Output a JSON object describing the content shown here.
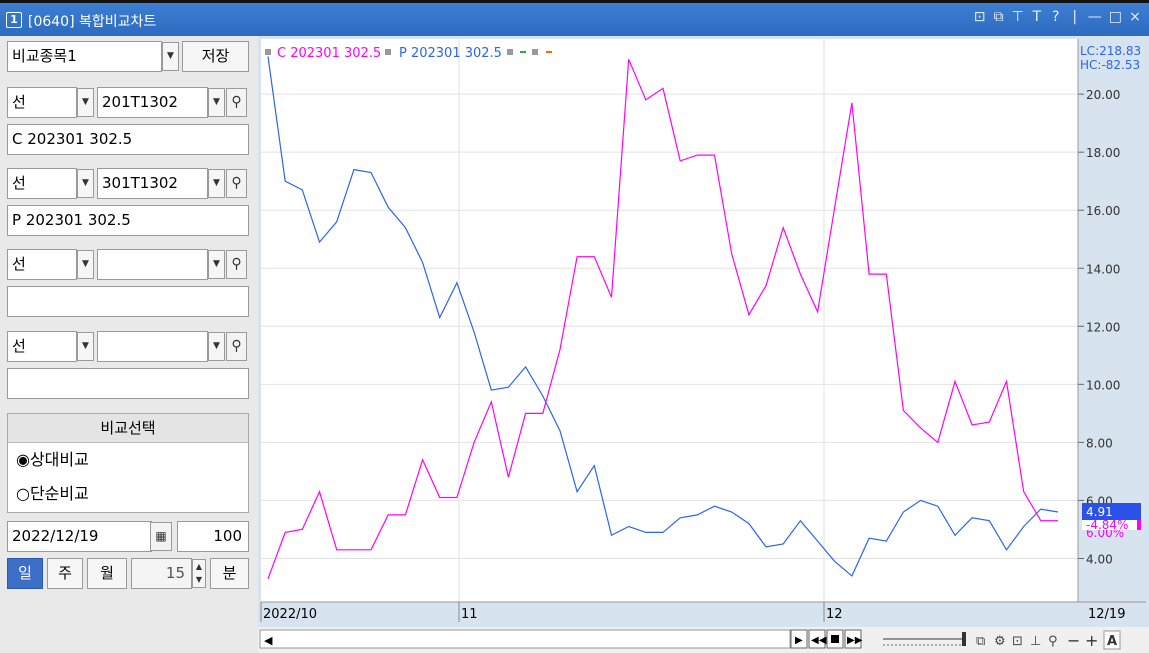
{
  "window": {
    "number": "1",
    "title": "[0640] 복합비교차트",
    "controls": [
      "⊡",
      "⧉",
      "⊤",
      "T",
      "?",
      "|",
      "—",
      "□",
      "×"
    ]
  },
  "left": {
    "compare_select": "비교종목1",
    "save_label": "저장",
    "rows": [
      {
        "kind": "선",
        "code": "201T1302",
        "name": "C 202301 302.5"
      },
      {
        "kind": "선",
        "code": "301T1302",
        "name": "P 202301 302.5"
      },
      {
        "kind": "선",
        "code": "",
        "name": ""
      },
      {
        "kind": "선",
        "code": "",
        "name": ""
      }
    ],
    "panel_title": "비교선택",
    "options": [
      "◉상대비교",
      "○단순비교"
    ],
    "date": "2022/12/19",
    "count": "100",
    "period_buttons": [
      "일",
      "주",
      "월"
    ],
    "minute_value": "15",
    "minute_label": "분"
  },
  "chart_data": {
    "type": "line",
    "legend": [
      "C 202301 302.5",
      "P 202301 302.5"
    ],
    "ylim": [
      2.5,
      21.9
    ],
    "y_ticks": [
      "20.00",
      "18.00",
      "16.00",
      "14.00",
      "12.00",
      "10.00",
      "8.00",
      "6.00",
      "4.00"
    ],
    "x_labels": [
      "2022/10",
      "11",
      "12",
      "12/19"
    ],
    "right_labels": [
      "LC:218.83",
      "HC:-82.53"
    ],
    "current": {
      "blue": "4.91",
      "magenta": "-4.84%",
      "hidden": "6.00%"
    },
    "series": [
      {
        "name": "C 202301 302.5",
        "color": "#ff00ff",
        "values": [
          3.3,
          4.9,
          5.0,
          6.3,
          4.3,
          4.3,
          4.3,
          5.5,
          5.5,
          7.4,
          6.1,
          6.1,
          8.0,
          9.4,
          6.8,
          9.0,
          9.0,
          11.2,
          14.4,
          14.4,
          13.0,
          21.2,
          19.8,
          20.2,
          17.7,
          17.9,
          17.9,
          14.5,
          12.4,
          13.4,
          15.4,
          13.8,
          12.5,
          16.1,
          19.7,
          13.8,
          13.8,
          9.1,
          8.5,
          8.0,
          10.1,
          8.6,
          8.7,
          10.1,
          6.3,
          5.3,
          5.3
        ]
      },
      {
        "name": "P 202301 302.5",
        "color": "#2b65f0",
        "values": [
          21.3,
          17.0,
          16.7,
          14.9,
          15.6,
          17.4,
          17.3,
          16.1,
          15.4,
          14.2,
          12.3,
          13.5,
          11.8,
          9.8,
          9.9,
          10.6,
          9.6,
          8.4,
          6.3,
          7.2,
          4.8,
          5.1,
          4.9,
          4.9,
          5.4,
          5.5,
          5.8,
          5.6,
          5.2,
          4.4,
          4.5,
          5.3,
          4.6,
          3.9,
          3.4,
          4.7,
          4.6,
          5.6,
          6.0,
          5.8,
          4.8,
          5.4,
          5.3,
          4.3,
          5.1,
          5.7,
          5.6
        ]
      }
    ]
  },
  "colors": {
    "titlebar": "#2f6fc4",
    "axis_panel": "#d7e3ef",
    "magenta": "#ff00ff",
    "blue": "#2b65f0",
    "active_btn": "#3b6fc8"
  }
}
